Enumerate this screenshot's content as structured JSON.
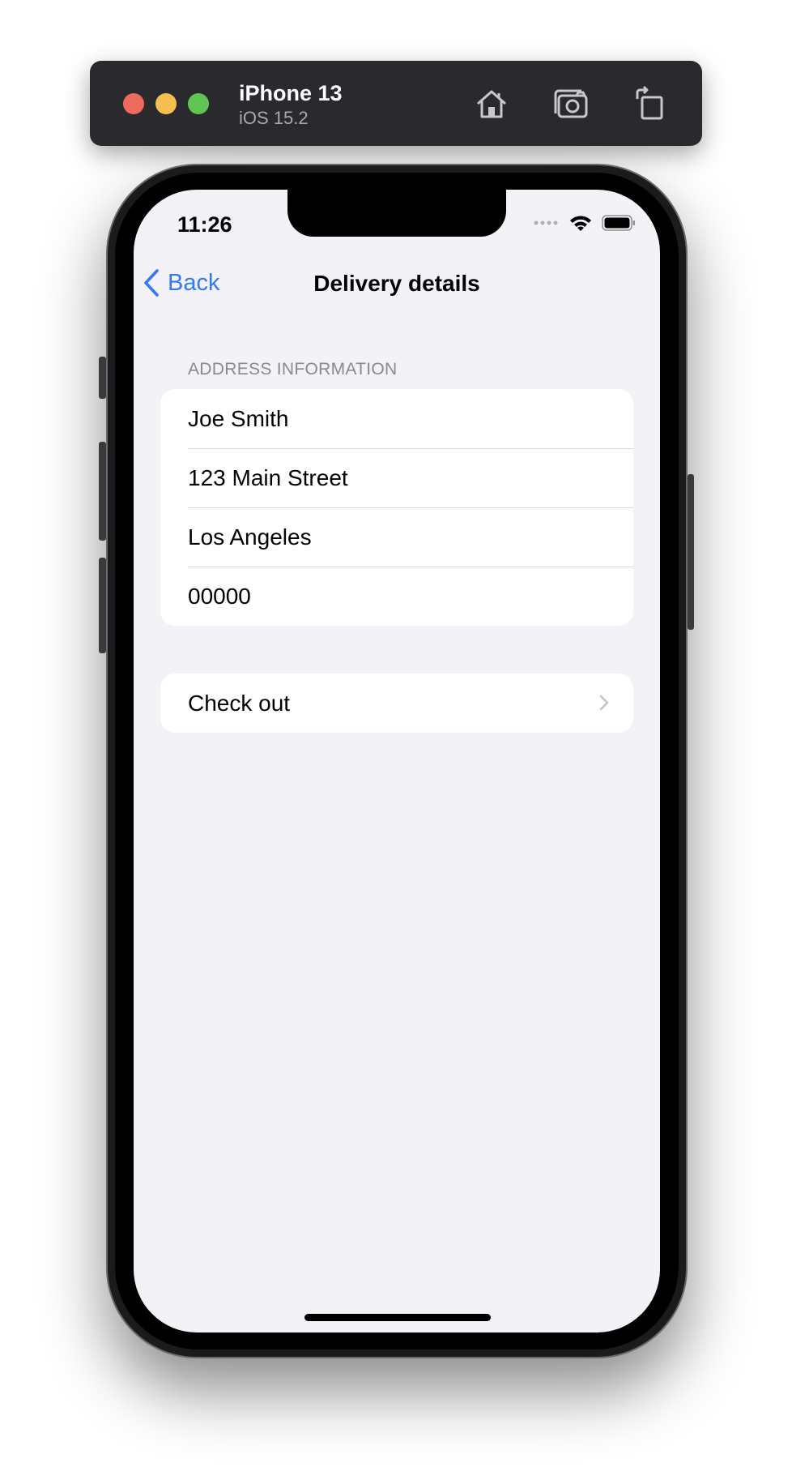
{
  "simulator": {
    "device_name": "iPhone 13",
    "os_version": "iOS 15.2",
    "toolbar_icons": [
      "home-icon",
      "screenshot-icon",
      "rotate-icon"
    ]
  },
  "status_bar": {
    "time": "11:26",
    "icons": [
      "cellular-dots-icon",
      "wifi-icon",
      "battery-icon"
    ]
  },
  "nav": {
    "back_label": "Back",
    "title": "Delivery details"
  },
  "address_section": {
    "header": "ADDRESS INFORMATION",
    "fields": [
      "Joe Smith",
      "123 Main Street",
      "Los Angeles",
      "00000"
    ]
  },
  "checkout": {
    "label": "Check out"
  },
  "colors": {
    "accent": "#3478f6",
    "background": "#f2f2f7",
    "cell": "#ffffff",
    "secondary_text": "#8a8a8e"
  }
}
